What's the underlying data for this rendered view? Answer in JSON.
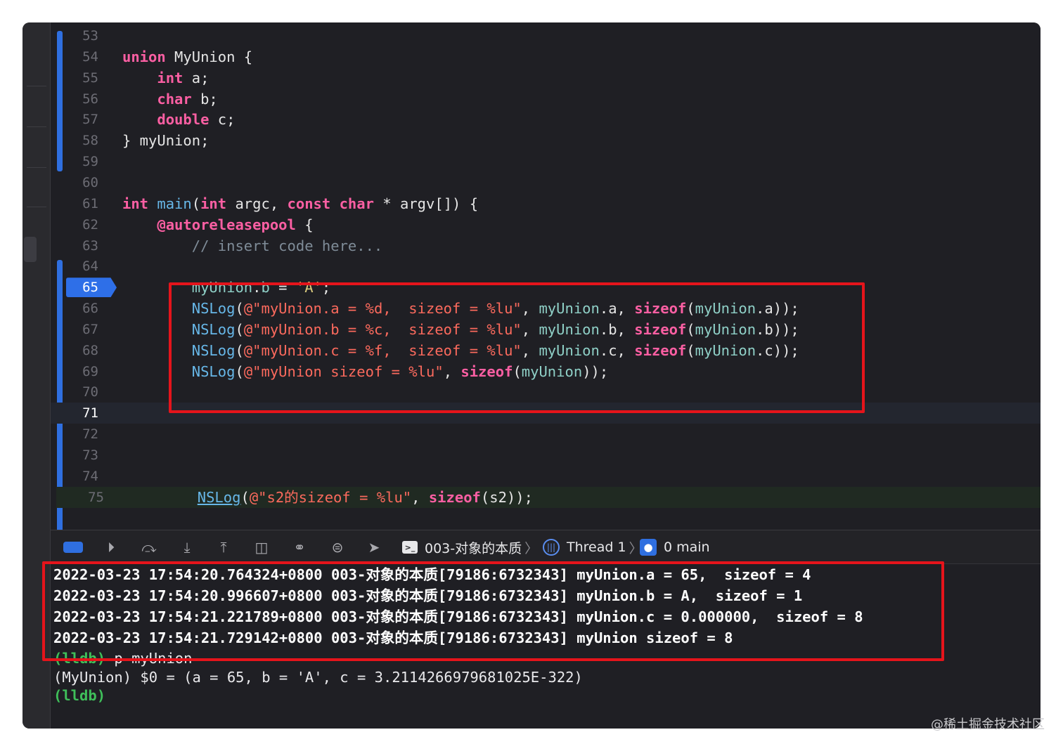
{
  "editor": {
    "lines": [
      {
        "num": "53",
        "segments": []
      },
      {
        "num": "54",
        "segments": [
          {
            "t": "union",
            "c": "k"
          },
          {
            "t": " MyUnion {",
            "c": "p"
          }
        ]
      },
      {
        "num": "55",
        "segments": [
          {
            "t": "    ",
            "c": "p"
          },
          {
            "t": "int",
            "c": "k"
          },
          {
            "t": " a;",
            "c": "p"
          }
        ]
      },
      {
        "num": "56",
        "segments": [
          {
            "t": "    ",
            "c": "p"
          },
          {
            "t": "char",
            "c": "k"
          },
          {
            "t": " b;",
            "c": "p"
          }
        ]
      },
      {
        "num": "57",
        "segments": [
          {
            "t": "    ",
            "c": "p"
          },
          {
            "t": "double",
            "c": "k"
          },
          {
            "t": " c;",
            "c": "p"
          }
        ]
      },
      {
        "num": "58",
        "segments": [
          {
            "t": "} myUnion;",
            "c": "p"
          }
        ]
      },
      {
        "num": "59",
        "segments": []
      },
      {
        "num": "60",
        "segments": []
      },
      {
        "num": "61",
        "segments": [
          {
            "t": "int",
            "c": "k"
          },
          {
            "t": " ",
            "c": "p"
          },
          {
            "t": "main",
            "c": "f"
          },
          {
            "t": "(",
            "c": "p"
          },
          {
            "t": "int",
            "c": "k"
          },
          {
            "t": " argc, ",
            "c": "p"
          },
          {
            "t": "const",
            "c": "k"
          },
          {
            "t": " ",
            "c": "p"
          },
          {
            "t": "char",
            "c": "k"
          },
          {
            "t": " * argv[]) {",
            "c": "p"
          }
        ]
      },
      {
        "num": "62",
        "segments": [
          {
            "t": "    ",
            "c": "p"
          },
          {
            "t": "@autoreleasepool",
            "c": "k"
          },
          {
            "t": " {",
            "c": "p"
          }
        ]
      },
      {
        "num": "63",
        "segments": [
          {
            "t": "        ",
            "c": "p"
          },
          {
            "t": "// insert code here...",
            "c": "cm"
          }
        ]
      },
      {
        "num": "64",
        "segments": []
      },
      {
        "num": "65",
        "current": true,
        "segments": [
          {
            "t": "        ",
            "c": "p"
          },
          {
            "t": "myUnion",
            "c": "n"
          },
          {
            "t": ".",
            "c": "p"
          },
          {
            "t": "b",
            "c": "n"
          },
          {
            "t": " = ",
            "c": "p"
          },
          {
            "t": "'A'",
            "c": "ch"
          },
          {
            "t": ";",
            "c": "p"
          }
        ]
      },
      {
        "num": "66",
        "segments": [
          {
            "t": "        ",
            "c": "p"
          },
          {
            "t": "NSLog",
            "c": "f"
          },
          {
            "t": "(",
            "c": "p"
          },
          {
            "t": "@\"myUnion.a = %d,  sizeof = %lu\"",
            "c": "s"
          },
          {
            "t": ", ",
            "c": "p"
          },
          {
            "t": "myUnion",
            "c": "n"
          },
          {
            "t": ".a, ",
            "c": "p"
          },
          {
            "t": "sizeof",
            "c": "k"
          },
          {
            "t": "(",
            "c": "p"
          },
          {
            "t": "myUnion",
            "c": "n"
          },
          {
            "t": ".a));",
            "c": "p"
          }
        ]
      },
      {
        "num": "67",
        "segments": [
          {
            "t": "        ",
            "c": "p"
          },
          {
            "t": "NSLog",
            "c": "f"
          },
          {
            "t": "(",
            "c": "p"
          },
          {
            "t": "@\"myUnion.b = %c,  sizeof = %lu\"",
            "c": "s"
          },
          {
            "t": ", ",
            "c": "p"
          },
          {
            "t": "myUnion",
            "c": "n"
          },
          {
            "t": ".b, ",
            "c": "p"
          },
          {
            "t": "sizeof",
            "c": "k"
          },
          {
            "t": "(",
            "c": "p"
          },
          {
            "t": "myUnion",
            "c": "n"
          },
          {
            "t": ".b));",
            "c": "p"
          }
        ]
      },
      {
        "num": "68",
        "segments": [
          {
            "t": "        ",
            "c": "p"
          },
          {
            "t": "NSLog",
            "c": "f"
          },
          {
            "t": "(",
            "c": "p"
          },
          {
            "t": "@\"myUnion.c = %f,  sizeof = %lu\"",
            "c": "s"
          },
          {
            "t": ", ",
            "c": "p"
          },
          {
            "t": "myUnion",
            "c": "n"
          },
          {
            "t": ".c, ",
            "c": "p"
          },
          {
            "t": "sizeof",
            "c": "k"
          },
          {
            "t": "(",
            "c": "p"
          },
          {
            "t": "myUnion",
            "c": "n"
          },
          {
            "t": ".c));",
            "c": "p"
          }
        ]
      },
      {
        "num": "69",
        "segments": [
          {
            "t": "        ",
            "c": "p"
          },
          {
            "t": "NSLog",
            "c": "f"
          },
          {
            "t": "(",
            "c": "p"
          },
          {
            "t": "@\"myUnion sizeof = %lu\"",
            "c": "s"
          },
          {
            "t": ", ",
            "c": "p"
          },
          {
            "t": "sizeof",
            "c": "k"
          },
          {
            "t": "(",
            "c": "p"
          },
          {
            "t": "myUnion",
            "c": "n"
          },
          {
            "t": "));",
            "c": "p"
          }
        ]
      },
      {
        "num": "70",
        "segments": []
      },
      {
        "num": "71",
        "highlight": "blue",
        "segments": []
      },
      {
        "num": "72",
        "segments": []
      },
      {
        "num": "73",
        "segments": []
      },
      {
        "num": "74",
        "segments": []
      },
      {
        "num": "75",
        "highlight": "green",
        "segments": [
          {
            "t": "        ",
            "c": "p"
          },
          {
            "t": "NSLog",
            "c": "f u"
          },
          {
            "t": "(",
            "c": "p"
          },
          {
            "t": "@\"s2的sizeof = %lu\"",
            "c": "s"
          },
          {
            "t": ", ",
            "c": "p"
          },
          {
            "t": "sizeof",
            "c": "k"
          },
          {
            "t": "(s2));",
            "c": "p"
          }
        ]
      }
    ]
  },
  "debug_bar": {
    "icons": [
      "breakpoints-toggle-icon",
      "continue-icon",
      "step-over-icon",
      "step-into-icon",
      "step-out-icon",
      "view-hierarchy-icon",
      "memory-graph-icon",
      "environment-icon",
      "location-icon"
    ],
    "target": "003-对象的本质",
    "thread": "Thread 1",
    "frame": "0 main"
  },
  "console": {
    "output": [
      "2022-03-23 17:54:20.764324+0800 003-对象的本质[79186:6732343] myUnion.a = 65,  sizeof = 4",
      "2022-03-23 17:54:20.996607+0800 003-对象的本质[79186:6732343] myUnion.b = A,  sizeof = 1",
      "2022-03-23 17:54:21.221789+0800 003-对象的本质[79186:6732343] myUnion.c = 0.000000,  sizeof = 8",
      "2022-03-23 17:54:21.729142+0800 003-对象的本质[79186:6732343] myUnion sizeof = 8"
    ],
    "command_prompt": "(lldb)",
    "command": " p myUnion",
    "result": "(MyUnion) $0 = (a = 65, b = 'A', c = 3.2114266979681025E-322)",
    "prompt": "(lldb)"
  },
  "watermark": "@稀土掘金技术社区",
  "colors": {
    "keyword": "#fc5fa3",
    "function": "#67b7e8",
    "string": "#fc6a5d",
    "identifier": "#8fd0c7",
    "annotation_box": "#e5141b",
    "lldb_prompt": "#3fbf5a",
    "accent": "#2f6fe0"
  }
}
